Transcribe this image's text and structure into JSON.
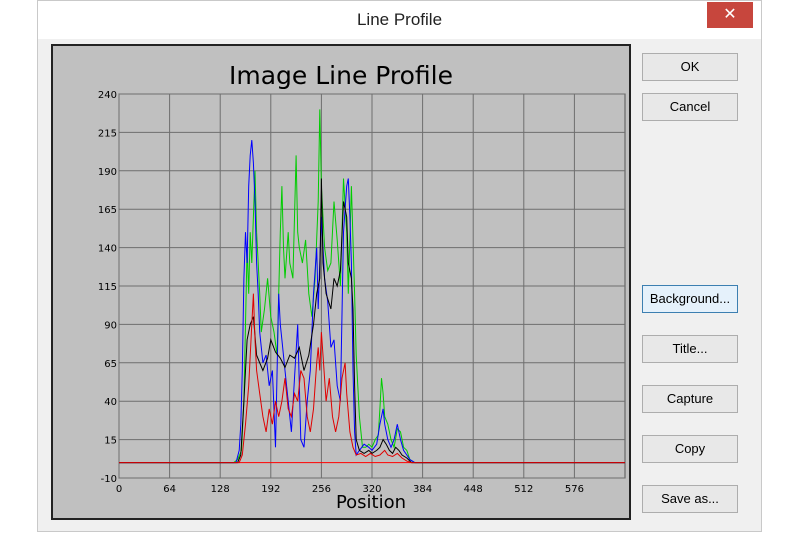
{
  "window": {
    "title": "Line Profile",
    "close_glyph": "✕"
  },
  "buttons": {
    "ok": "OK",
    "cancel": "Cancel",
    "background": "Background...",
    "title": "Title...",
    "capture": "Capture",
    "copy": "Copy",
    "save_as": "Save as..."
  },
  "chart_data": {
    "type": "line",
    "title": "Image Line Profile",
    "xlabel": "Position",
    "ylabel": "",
    "xlim": [
      0,
      640
    ],
    "ylim": [
      -10,
      240
    ],
    "xticks": [
      0,
      64,
      128,
      192,
      256,
      320,
      384,
      448,
      512,
      576
    ],
    "yticks": [
      -10,
      15,
      40,
      65,
      90,
      115,
      140,
      165,
      190,
      215,
      240
    ],
    "grid": true,
    "background": "#c0c0c0",
    "baseline": {
      "y": 0,
      "color": "#ff0000"
    },
    "series": [
      {
        "color": "#00cc00",
        "points": [
          [
            0,
            0
          ],
          [
            145,
            0
          ],
          [
            150,
            2
          ],
          [
            155,
            8
          ],
          [
            158,
            40
          ],
          [
            160,
            90
          ],
          [
            162,
            140
          ],
          [
            164,
            110
          ],
          [
            166,
            150
          ],
          [
            168,
            130
          ],
          [
            170,
            160
          ],
          [
            172,
            190
          ],
          [
            174,
            150
          ],
          [
            176,
            130
          ],
          [
            178,
            110
          ],
          [
            180,
            85
          ],
          [
            184,
            100
          ],
          [
            188,
            120
          ],
          [
            192,
            95
          ],
          [
            196,
            85
          ],
          [
            200,
            70
          ],
          [
            204,
            150
          ],
          [
            206,
            180
          ],
          [
            208,
            140
          ],
          [
            210,
            120
          ],
          [
            214,
            150
          ],
          [
            216,
            130
          ],
          [
            220,
            120
          ],
          [
            224,
            200
          ],
          [
            226,
            150
          ],
          [
            228,
            140
          ],
          [
            232,
            130
          ],
          [
            236,
            145
          ],
          [
            240,
            110
          ],
          [
            244,
            95
          ],
          [
            248,
            120
          ],
          [
            252,
            170
          ],
          [
            254,
            230
          ],
          [
            256,
            180
          ],
          [
            260,
            140
          ],
          [
            264,
            125
          ],
          [
            268,
            130
          ],
          [
            272,
            170
          ],
          [
            276,
            145
          ],
          [
            280,
            115
          ],
          [
            284,
            185
          ],
          [
            288,
            150
          ],
          [
            290,
            110
          ],
          [
            294,
            180
          ],
          [
            298,
            110
          ],
          [
            300,
            70
          ],
          [
            304,
            30
          ],
          [
            308,
            10
          ],
          [
            312,
            10
          ],
          [
            316,
            12
          ],
          [
            320,
            10
          ],
          [
            324,
            15
          ],
          [
            328,
            18
          ],
          [
            330,
            35
          ],
          [
            332,
            55
          ],
          [
            334,
            45
          ],
          [
            336,
            30
          ],
          [
            340,
            25
          ],
          [
            344,
            15
          ],
          [
            348,
            10
          ],
          [
            352,
            22
          ],
          [
            356,
            20
          ],
          [
            360,
            10
          ],
          [
            364,
            8
          ],
          [
            368,
            2
          ],
          [
            374,
            0
          ],
          [
            640,
            0
          ]
        ]
      },
      {
        "color": "#0000ff",
        "points": [
          [
            0,
            0
          ],
          [
            148,
            0
          ],
          [
            152,
            8
          ],
          [
            154,
            25
          ],
          [
            156,
            60
          ],
          [
            158,
            120
          ],
          [
            160,
            150
          ],
          [
            162,
            130
          ],
          [
            164,
            180
          ],
          [
            166,
            200
          ],
          [
            168,
            210
          ],
          [
            170,
            195
          ],
          [
            172,
            170
          ],
          [
            174,
            130
          ],
          [
            176,
            110
          ],
          [
            178,
            85
          ],
          [
            182,
            65
          ],
          [
            186,
            70
          ],
          [
            190,
            50
          ],
          [
            194,
            60
          ],
          [
            198,
            10
          ],
          [
            200,
            60
          ],
          [
            202,
            110
          ],
          [
            204,
            90
          ],
          [
            206,
            80
          ],
          [
            210,
            60
          ],
          [
            214,
            40
          ],
          [
            218,
            20
          ],
          [
            222,
            55
          ],
          [
            226,
            90
          ],
          [
            230,
            15
          ],
          [
            234,
            10
          ],
          [
            238,
            40
          ],
          [
            242,
            60
          ],
          [
            246,
            110
          ],
          [
            250,
            140
          ],
          [
            252,
            100
          ],
          [
            256,
            160
          ],
          [
            260,
            120
          ],
          [
            264,
            105
          ],
          [
            268,
            75
          ],
          [
            272,
            80
          ],
          [
            276,
            50
          ],
          [
            280,
            40
          ],
          [
            284,
            150
          ],
          [
            288,
            180
          ],
          [
            290,
            185
          ],
          [
            292,
            160
          ],
          [
            294,
            130
          ],
          [
            296,
            60
          ],
          [
            298,
            20
          ],
          [
            300,
            5
          ],
          [
            304,
            8
          ],
          [
            310,
            12
          ],
          [
            316,
            10
          ],
          [
            320,
            8
          ],
          [
            326,
            12
          ],
          [
            330,
            25
          ],
          [
            334,
            35
          ],
          [
            336,
            25
          ],
          [
            340,
            15
          ],
          [
            344,
            10
          ],
          [
            348,
            15
          ],
          [
            352,
            25
          ],
          [
            356,
            15
          ],
          [
            360,
            8
          ],
          [
            364,
            5
          ],
          [
            368,
            2
          ],
          [
            374,
            0
          ],
          [
            640,
            0
          ]
        ]
      },
      {
        "color": "#000000",
        "points": [
          [
            0,
            0
          ],
          [
            150,
            0
          ],
          [
            154,
            5
          ],
          [
            158,
            40
          ],
          [
            162,
            80
          ],
          [
            166,
            90
          ],
          [
            170,
            95
          ],
          [
            174,
            70
          ],
          [
            178,
            65
          ],
          [
            182,
            60
          ],
          [
            188,
            68
          ],
          [
            192,
            80
          ],
          [
            198,
            72
          ],
          [
            204,
            68
          ],
          [
            210,
            62
          ],
          [
            216,
            70
          ],
          [
            222,
            68
          ],
          [
            228,
            75
          ],
          [
            234,
            60
          ],
          [
            240,
            70
          ],
          [
            246,
            90
          ],
          [
            250,
            110
          ],
          [
            254,
            120
          ],
          [
            256,
            185
          ],
          [
            258,
            130
          ],
          [
            262,
            110
          ],
          [
            268,
            100
          ],
          [
            272,
            120
          ],
          [
            276,
            115
          ],
          [
            280,
            125
          ],
          [
            284,
            170
          ],
          [
            288,
            160
          ],
          [
            290,
            130
          ],
          [
            294,
            120
          ],
          [
            296,
            100
          ],
          [
            298,
            50
          ],
          [
            300,
            15
          ],
          [
            304,
            8
          ],
          [
            310,
            6
          ],
          [
            316,
            8
          ],
          [
            320,
            6
          ],
          [
            326,
            8
          ],
          [
            330,
            10
          ],
          [
            334,
            15
          ],
          [
            338,
            12
          ],
          [
            342,
            8
          ],
          [
            346,
            6
          ],
          [
            350,
            10
          ],
          [
            354,
            8
          ],
          [
            358,
            5
          ],
          [
            364,
            3
          ],
          [
            370,
            0
          ],
          [
            640,
            0
          ]
        ]
      },
      {
        "color": "#e00000",
        "points": [
          [
            0,
            0
          ],
          [
            152,
            0
          ],
          [
            156,
            5
          ],
          [
            160,
            25
          ],
          [
            164,
            50
          ],
          [
            168,
            90
          ],
          [
            170,
            110
          ],
          [
            172,
            80
          ],
          [
            174,
            60
          ],
          [
            178,
            45
          ],
          [
            182,
            30
          ],
          [
            186,
            20
          ],
          [
            190,
            35
          ],
          [
            194,
            25
          ],
          [
            198,
            40
          ],
          [
            202,
            30
          ],
          [
            206,
            40
          ],
          [
            210,
            55
          ],
          [
            214,
            35
          ],
          [
            218,
            30
          ],
          [
            222,
            45
          ],
          [
            226,
            40
          ],
          [
            230,
            60
          ],
          [
            234,
            55
          ],
          [
            238,
            30
          ],
          [
            242,
            20
          ],
          [
            246,
            35
          ],
          [
            250,
            65
          ],
          [
            252,
            75
          ],
          [
            254,
            60
          ],
          [
            256,
            85
          ],
          [
            258,
            70
          ],
          [
            262,
            40
          ],
          [
            266,
            55
          ],
          [
            270,
            30
          ],
          [
            274,
            20
          ],
          [
            278,
            30
          ],
          [
            282,
            55
          ],
          [
            286,
            65
          ],
          [
            288,
            45
          ],
          [
            292,
            20
          ],
          [
            296,
            10
          ],
          [
            300,
            5
          ],
          [
            306,
            6
          ],
          [
            312,
            4
          ],
          [
            318,
            6
          ],
          [
            324,
            4
          ],
          [
            330,
            5
          ],
          [
            336,
            8
          ],
          [
            340,
            5
          ],
          [
            346,
            4
          ],
          [
            352,
            6
          ],
          [
            358,
            3
          ],
          [
            364,
            1
          ],
          [
            370,
            0
          ],
          [
            640,
            0
          ]
        ]
      }
    ]
  }
}
